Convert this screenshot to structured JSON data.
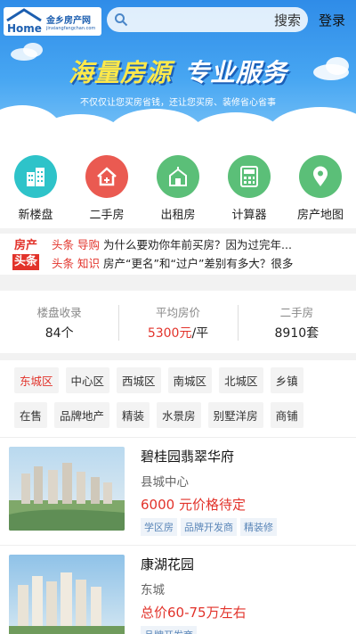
{
  "header": {
    "logo_cn": "金乡房产网",
    "logo_en": "jinxiangfangchan.com",
    "logo_word": "Home",
    "search_placeholder": "",
    "search_button": "搜索",
    "login": "登录"
  },
  "banner": {
    "slogan_left": "海量房源",
    "slogan_right": "专业服务",
    "subtitle": "不仅仅让您买房省钱，还让您买房、装修省心省事"
  },
  "nav": [
    {
      "label": "新楼盘",
      "icon": "building-icon",
      "color": "#2ec3c9"
    },
    {
      "label": "二手房",
      "icon": "house-icon",
      "color": "#ea5a51"
    },
    {
      "label": "出租房",
      "icon": "rental-house-icon",
      "color": "#5bbf78"
    },
    {
      "label": "计算器",
      "icon": "calculator-icon",
      "color": "#5bbf78"
    },
    {
      "label": "房产地图",
      "icon": "map-pin-icon",
      "color": "#5bbf78"
    }
  ],
  "headlines": {
    "badge_top": "房产",
    "badge_bottom": "头条",
    "items": [
      {
        "tag1": "头条",
        "tag2": "导购",
        "text": "为什么要劝你年前买房？因为过完年..."
      },
      {
        "tag1": "头条",
        "tag2": "知识",
        "text": "房产“更名”和“过户”差别有多大？很多"
      }
    ]
  },
  "stats": [
    {
      "label": "楼盘收录",
      "value": "84个"
    },
    {
      "label": "平均房价",
      "value_red": "5300元",
      "value_suffix": "/平"
    },
    {
      "label": "二手房",
      "value": "8910套"
    }
  ],
  "filters": {
    "row1": [
      "东城区",
      "中心区",
      "西城区",
      "南城区",
      "北城区",
      "乡镇"
    ],
    "row2": [
      "在售",
      "品牌地产",
      "精装",
      "水景房",
      "别墅洋房",
      "商铺"
    ],
    "active": "东城区"
  },
  "listings": [
    {
      "name": "碧桂园翡翠华府",
      "location": "县城中心",
      "price": "6000 元价格待定",
      "tags": [
        "学区房",
        "品牌开发商",
        "精装修"
      ]
    },
    {
      "name": "康湖花园",
      "location": "东城",
      "price": "总价60-75万左右",
      "tags": [
        "品牌开发商"
      ]
    }
  ],
  "colors": {
    "accent_red": "#e2332b",
    "banner_blue": "#2f8ce8",
    "slogan_yellow": "#ffe94a"
  }
}
